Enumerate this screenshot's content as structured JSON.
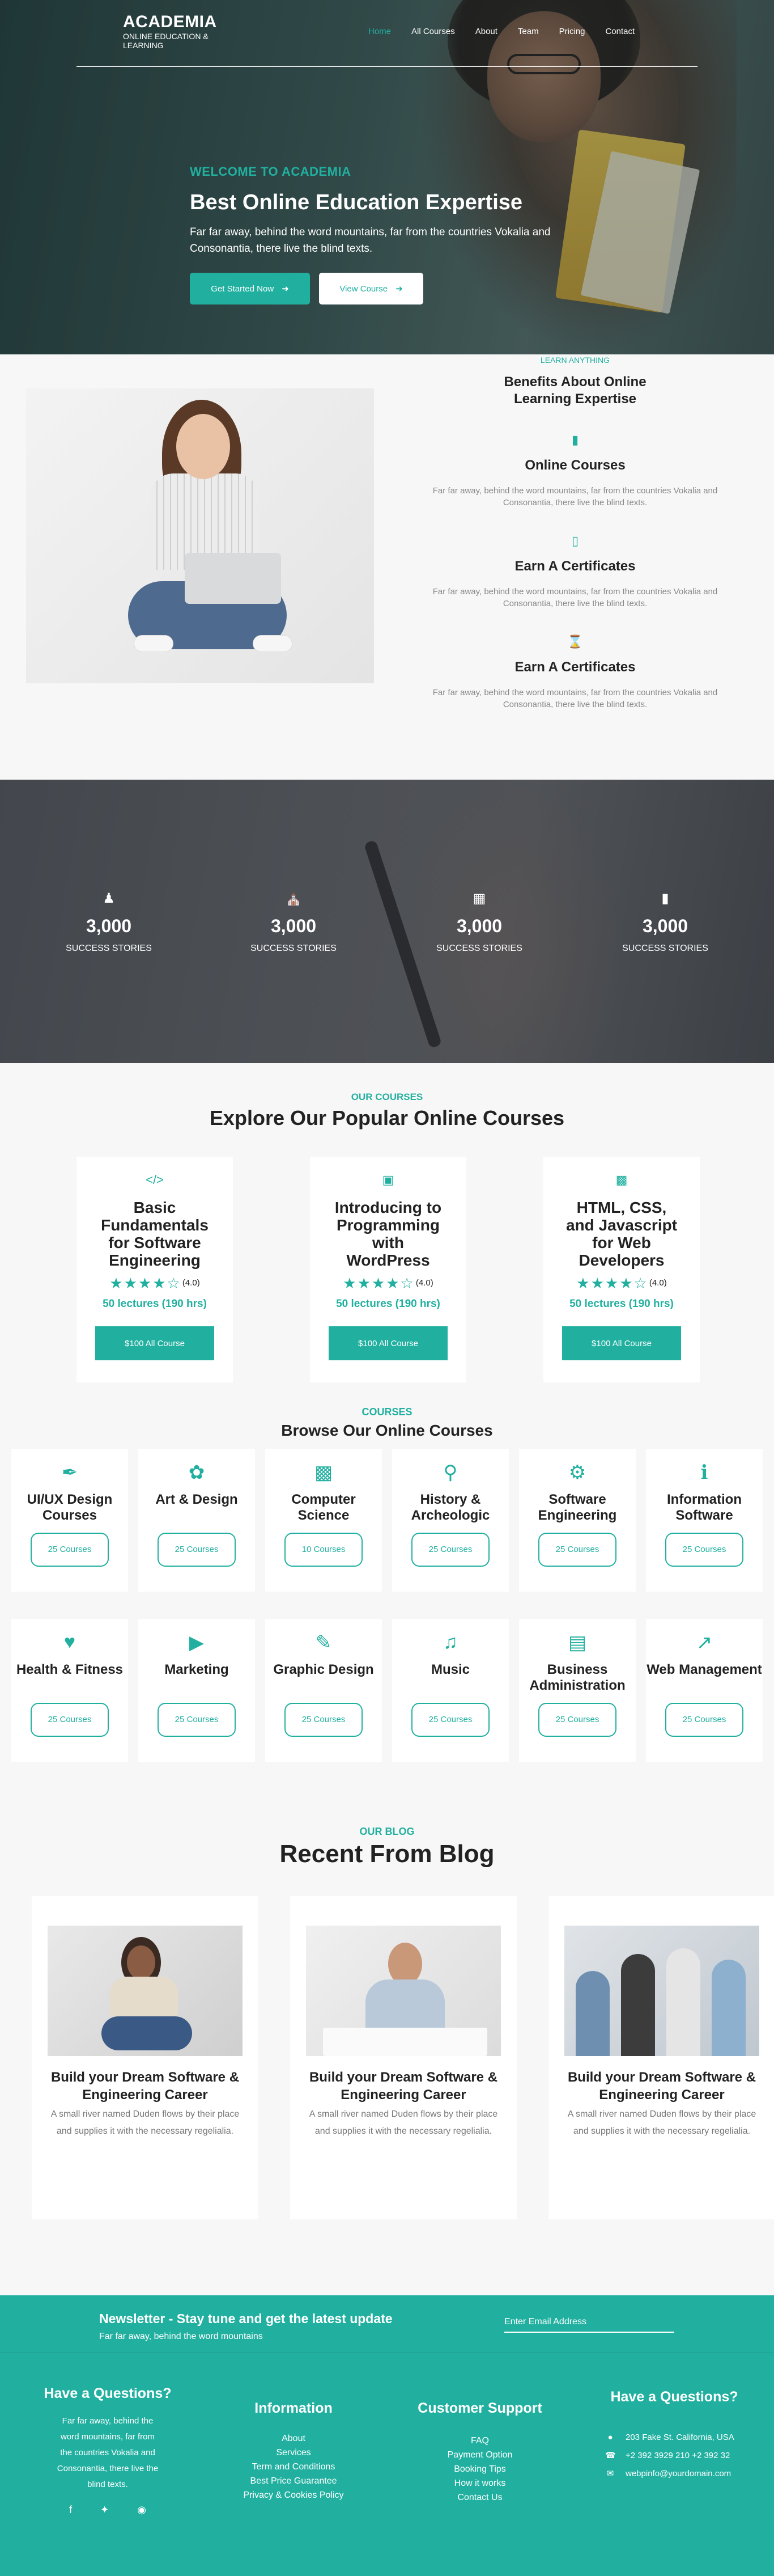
{
  "brand": {
    "title": "ACADEMIA",
    "subtitle": "ONLINE EDUCATION & LEARNING"
  },
  "nav": {
    "items": [
      "Home",
      "All Courses",
      "About",
      "Team",
      "Pricing",
      "Contact"
    ],
    "active": "Home"
  },
  "hero": {
    "kicker": "WELCOME TO ACADEMIA",
    "title": "Best Online Education Expertise",
    "description": "Far far away, behind the word mountains, far from the countries Vokalia and Consonantia, there live the blind texts.",
    "primary_button": "Get Started Now",
    "secondary_button": "View Course"
  },
  "benefits": {
    "kicker": "LEARN ANYTHING",
    "title": "Benefits About Online Learning Expertise",
    "items": [
      {
        "icon": "book-icon",
        "title": "Online Courses",
        "text": "Far far away, behind the word mountains, far from the countries Vokalia and Consonantia, there live the blind texts."
      },
      {
        "icon": "file-icon",
        "title": "Earn A Certificates",
        "text": "Far far away, behind the word mountains, far from the countries Vokalia and Consonantia, there live the blind texts."
      },
      {
        "icon": "hourglass-icon",
        "title": "Earn A Certificates",
        "text": "Far far away, behind the word mountains, far from the countries Vokalia and Consonantia, there live the blind texts."
      }
    ]
  },
  "stats": [
    {
      "icon": "user-icon",
      "value": "3,000",
      "label": "SUCCESS STORIES"
    },
    {
      "icon": "school-icon",
      "value": "3,000",
      "label": "SUCCESS STORIES"
    },
    {
      "icon": "calendar-icon",
      "value": "3,000",
      "label": "SUCCESS STORIES"
    },
    {
      "icon": "book-icon",
      "value": "3,000",
      "label": "SUCCESS STORIES"
    }
  ],
  "popular": {
    "kicker": "OUR COURSES",
    "title": "Explore Our Popular Online Courses",
    "courses": [
      {
        "icon": "code-icon",
        "title": "Basic Fundamentals for Software Engineering",
        "rating": "(4.0)",
        "lectures": "50 lectures (190 hrs)",
        "button": "$100 All Course"
      },
      {
        "icon": "laptop-icon",
        "title": "Introducing to Programming with WordPress",
        "rating": "(4.0)",
        "lectures": "50 lectures (190 hrs)",
        "button": "$100 All Course"
      },
      {
        "icon": "desktop-icon",
        "title": "HTML, CSS, and Javascript for Web Developers",
        "rating": "(4.0)",
        "lectures": "50 lectures (190 hrs)",
        "button": "$100 All Course"
      }
    ]
  },
  "browse": {
    "kicker": "COURSES",
    "title": "Browse Our Online Courses",
    "categories": [
      {
        "icon": "pen-nib-icon",
        "name": "UI/UX Design Courses",
        "count": "25 Courses"
      },
      {
        "icon": "palette-icon",
        "name": "Art & Design",
        "count": "25 Courses"
      },
      {
        "icon": "computer-icon",
        "name": "Computer Science",
        "count": "10 Courses"
      },
      {
        "icon": "search-history-icon",
        "name": "History & Archeologic",
        "count": "25 Courses"
      },
      {
        "icon": "user-gear-icon",
        "name": "Software Engineering",
        "count": "25 Courses"
      },
      {
        "icon": "info-icon",
        "name": "Information Software",
        "count": "25 Courses"
      },
      {
        "icon": "hand-heart-icon",
        "name": "Health & Fitness",
        "count": "25 Courses"
      },
      {
        "icon": "video-icon",
        "name": "Marketing",
        "count": "25 Courses"
      },
      {
        "icon": "pencil-icon",
        "name": "Graphic Design",
        "count": "25 Courses"
      },
      {
        "icon": "music-icon",
        "name": "Music",
        "count": "25 Courses"
      },
      {
        "icon": "briefcase-icon",
        "name": "Business Administration",
        "count": "25 Courses"
      },
      {
        "icon": "chart-line-icon",
        "name": "Web Management",
        "count": "25 Courses"
      }
    ]
  },
  "blog": {
    "kicker": "OUR BLOG",
    "title": "Recent From Blog",
    "posts": [
      {
        "title": "Build your Dream Software & Engineering Career",
        "text": "A small river named Duden flows by their place and supplies it with the necessary regelialia."
      },
      {
        "title": "Build your Dream Software & Engineering Career",
        "text": "A small river named Duden flows by their place and supplies it with the necessary regelialia."
      },
      {
        "title": "Build your Dream Software & Engineering Career",
        "text": "A small river named Duden flows by their place and supplies it with the necessary regelialia."
      }
    ]
  },
  "newsletter": {
    "title": "Newsletter - Stay tune and get the latest update",
    "subtitle": "Far far away, behind the word mountains",
    "placeholder": "Enter Email Address"
  },
  "footer": {
    "about": {
      "title": "Have a Questions?",
      "text": "Far far away, behind the word mountains, far from the countries Vokalia and Consonantia, there live the blind texts."
    },
    "information": {
      "title": "Information",
      "links": [
        "About",
        "Services",
        "Term and Conditions",
        "Best Price Guarantee",
        "Privacy & Cookies Policy"
      ]
    },
    "support": {
      "title": "Customer Support",
      "links": [
        "FAQ",
        "Payment Option",
        "Booking Tips",
        "How it works",
        "Contact Us"
      ]
    },
    "contact": {
      "title": "Have a Questions?",
      "address": "203 Fake St. California, USA",
      "phone": "+2 392 3929 210 +2 392 32",
      "email": "webpinfo@yourdomain.com"
    }
  },
  "colors": {
    "accent": "#21b0a0",
    "background": "#f7f7f7",
    "text": "#222222"
  }
}
